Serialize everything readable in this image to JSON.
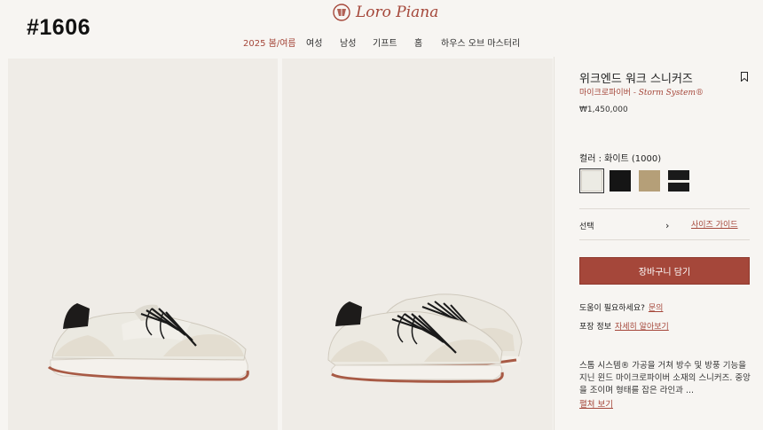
{
  "overlay": {
    "badge": "#1606"
  },
  "brand": {
    "name": "Loro Piana"
  },
  "nav": {
    "items": [
      {
        "label": "2025 봄/여름",
        "accent": true
      },
      {
        "label": "여성"
      },
      {
        "label": "남성"
      },
      {
        "label": "기프트"
      },
      {
        "label": "홈"
      },
      {
        "label": "하우스 오브 마스터리"
      }
    ]
  },
  "product": {
    "title": "위크엔드 워크 스니커즈",
    "subtitle_ko": "마이크로파이버",
    "subtitle_en": " - Storm System®",
    "price": "₩1,450,000",
    "color_label": "컬러 : 화이트 (1000)",
    "swatches": [
      {
        "name": "white",
        "color": "#ecebe4",
        "selected": true
      },
      {
        "name": "black",
        "color": "#151515"
      },
      {
        "name": "taupe",
        "color": "#b59f78"
      },
      {
        "name": "black-white",
        "color": "#1a1a1a"
      }
    ],
    "select_label": "선택",
    "size_guide": "사이즈 가이드",
    "add_to_cart": "장바구니 담기",
    "help_label": "도움이 필요하세요?",
    "help_link": "문의",
    "packaging_label": "포장 정보",
    "packaging_link": "자세히 알아보기",
    "description": "스톰 시스템® 가공을 거쳐 방수 및 방풍 기능을 지닌 윈드 마이크로파이버 소재의 스니커즈. 중앙을 조이며 형태를 잡은 라인과 ...",
    "read_more": "펼쳐 보기"
  },
  "colors": {
    "accent": "#a5473a",
    "panel": "#efece7",
    "page": "#f7f5f2"
  }
}
